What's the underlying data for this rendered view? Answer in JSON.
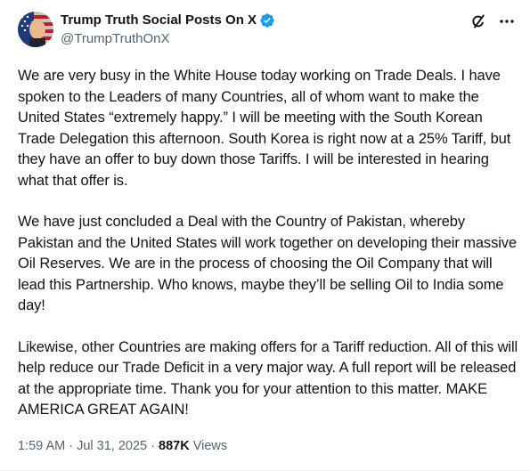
{
  "post": {
    "display_name": "Trump Truth Social Posts On X",
    "handle": "@TrumpTruthOnX",
    "paragraphs": [
      "We are very busy in the White House today working on Trade Deals. I have spoken to the Leaders of many Countries, all of whom want to make the United States “extremely happy.” I will be meeting with the South Korean Trade Delegation this afternoon. South Korea is right now at a 25% Tariff, but they have an offer to buy down those Tariffs. I will be interested in hearing what that offer is.",
      "We have just concluded a Deal with the Country of Pakistan, whereby Pakistan and the United States will work together on developing their massive Oil Reserves. We are in the process of choosing the Oil Company that will lead this Partnership. Who knows, maybe they’ll be selling Oil to India some day!",
      "Likewise, other Countries are making offers for a Tariff reduction. All of this will help reduce our Trade Deficit in a very major way. A full report will be released at the appropriate time. Thank you for your attention to this matter. MAKE AMERICA GREAT AGAIN!"
    ],
    "time": "1:59 AM",
    "date": "Jul 31, 2025",
    "separator": "·",
    "views_count": "887K",
    "views_label": "Views"
  },
  "icons": {
    "verified": "verified-badge-icon",
    "grok": "grok-icon",
    "more": "more-icon"
  },
  "colors": {
    "verified_blue": "#1d9bf0",
    "text_primary": "#0f1419",
    "text_secondary": "#536471"
  }
}
